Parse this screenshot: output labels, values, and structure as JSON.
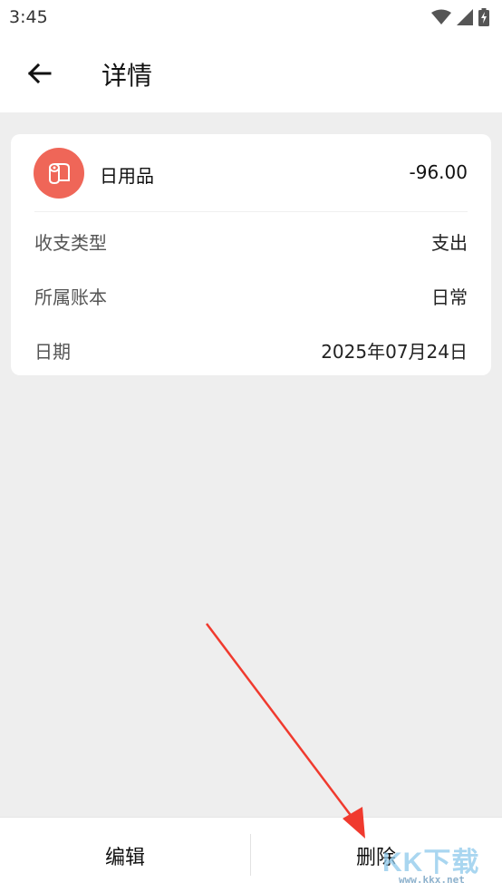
{
  "status_bar": {
    "time": "3:45",
    "icons": [
      "wifi-icon",
      "cell-signal-icon",
      "battery-charging-icon"
    ]
  },
  "app_bar": {
    "back_icon": "arrow-left-icon",
    "title": "详情"
  },
  "record": {
    "category_icon": "toilet-paper-icon",
    "category_color": "#ef6658",
    "category": "日用品",
    "amount": "-96.00",
    "rows": [
      {
        "label": "收支类型",
        "value": "支出"
      },
      {
        "label": "所属账本",
        "value": "日常"
      },
      {
        "label": "日期",
        "value": "2025年07月24日"
      }
    ]
  },
  "actions": {
    "edit_label": "编辑",
    "delete_label": "删除"
  },
  "annotation": {
    "arrow_color": "#f03a2e"
  },
  "watermark": {
    "text": "KK下载",
    "url": "www.kkx.net"
  }
}
